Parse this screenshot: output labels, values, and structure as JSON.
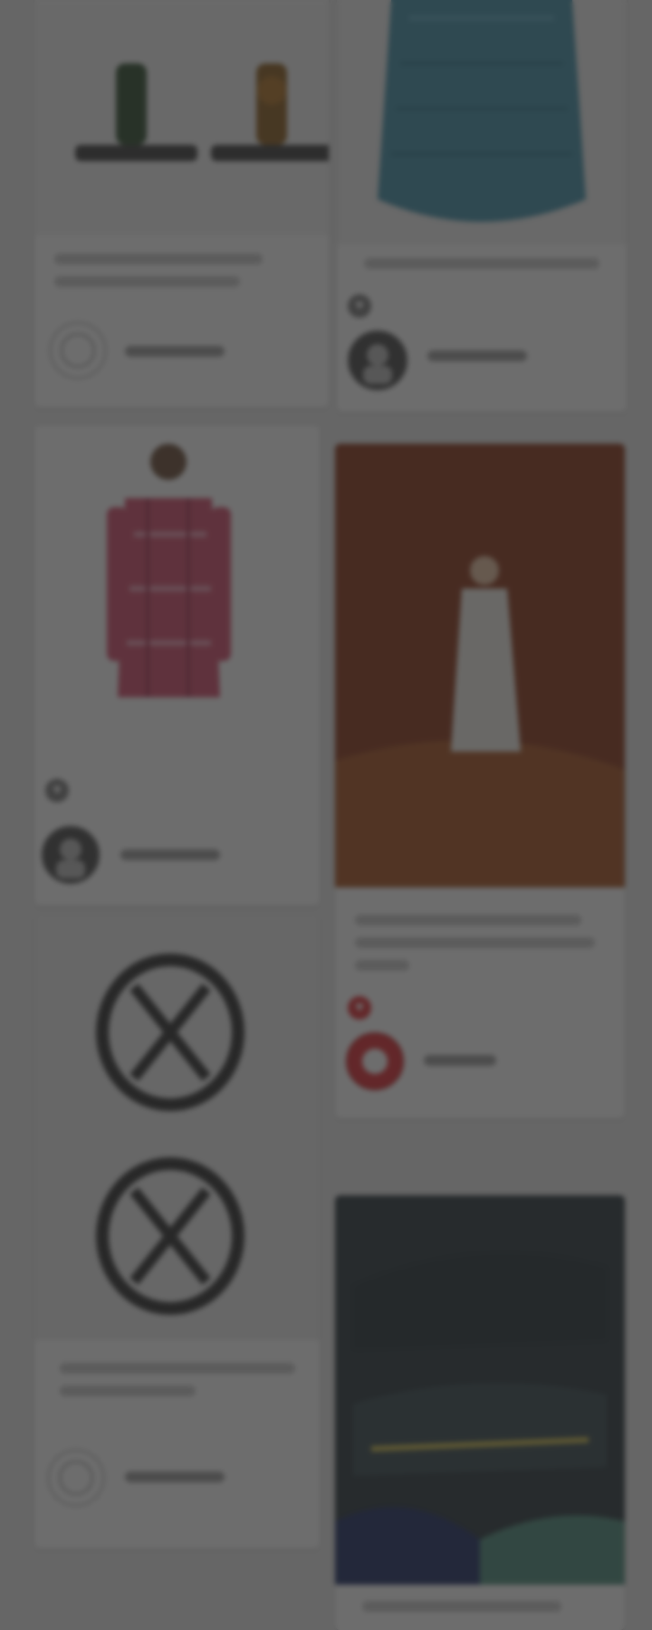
{
  "feed": {
    "cards": [
      {
        "id": "card-1",
        "image": "watch-bands-icon",
        "avatar": "grey-user-icon"
      },
      {
        "id": "card-2",
        "image": "blue-sweater-icon",
        "avatar": "dark-user-icon"
      },
      {
        "id": "card-3",
        "image": "plaid-shirt-model-icon",
        "avatar": "dark-user-icon"
      },
      {
        "id": "card-4",
        "image": "white-dress-model-icon",
        "avatar": "red-user-icon"
      },
      {
        "id": "card-5",
        "image": "sandals-icon",
        "avatar": "grey-user-icon"
      },
      {
        "id": "card-6",
        "image": "sneakers-icon"
      }
    ]
  },
  "colors": {
    "page_background": "#e9e9e9",
    "overlay": "rgba(40,40,40,0.68)",
    "heart_red": "#e0282f"
  }
}
